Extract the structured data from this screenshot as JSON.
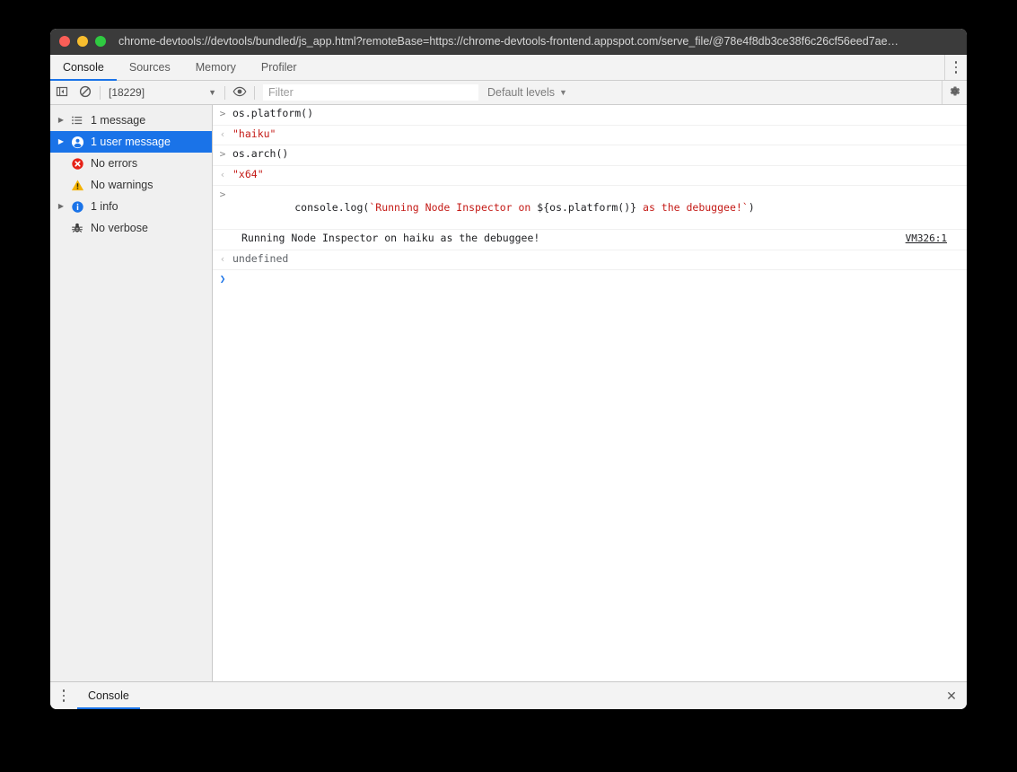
{
  "window": {
    "title": "chrome-devtools://devtools/bundled/js_app.html?remoteBase=https://chrome-devtools-frontend.appspot.com/serve_file/@78e4f8db3ce38f6c26cf56eed7ae…",
    "traffic_lights": [
      "close-red",
      "minimize-yellow",
      "zoom-green"
    ]
  },
  "tabbar": {
    "tabs": [
      {
        "label": "Console",
        "active": true
      },
      {
        "label": "Sources",
        "active": false
      },
      {
        "label": "Memory",
        "active": false
      },
      {
        "label": "Profiler",
        "active": false
      }
    ],
    "more_icon": "kebab-menu-icon"
  },
  "toolbar": {
    "sidebar_toggle_icon": "show-console-sidebar-icon",
    "clear_icon": "clear-console-icon",
    "context": {
      "value": "[18229]",
      "caret": "▼"
    },
    "eye_icon": "live-expression-eye-icon",
    "filter": {
      "value": "",
      "placeholder": "Filter"
    },
    "levels": {
      "label": "Default levels",
      "caret": "▼"
    },
    "settings_icon": "gear-icon"
  },
  "sidebar": {
    "items": [
      {
        "label": "1 message",
        "icon": "list-icon",
        "twisty": "▶",
        "selected": false
      },
      {
        "label": "1 user message",
        "icon": "user-icon",
        "twisty": "▶",
        "selected": true
      },
      {
        "label": "No errors",
        "icon": "error-icon",
        "twisty": "",
        "selected": false
      },
      {
        "label": "No warnings",
        "icon": "warning-icon",
        "twisty": "",
        "selected": false
      },
      {
        "label": "1 info",
        "icon": "info-icon",
        "twisty": "▶",
        "selected": false
      },
      {
        "label": "No verbose",
        "icon": "bug-icon",
        "twisty": "",
        "selected": false
      }
    ]
  },
  "console": {
    "rows": [
      {
        "gutter": ">",
        "kind": "input",
        "text": "os.platform()"
      },
      {
        "gutter": "‹",
        "kind": "output",
        "text": "\"haiku\"",
        "color": "string"
      },
      {
        "gutter": ">",
        "kind": "input",
        "text": "os.arch()"
      },
      {
        "gutter": "‹",
        "kind": "output",
        "text": "\"x64\"",
        "color": "string"
      },
      {
        "gutter": ">",
        "kind": "input",
        "text": "console.log(`Running Node Inspector on ${os.platform()} as the debuggee!`)",
        "parts": [
          {
            "t": "console.log(",
            "c": "plain"
          },
          {
            "t": "`Running Node Inspector on ",
            "c": "string"
          },
          {
            "t": "${",
            "c": "plain"
          },
          {
            "t": "os.platform()",
            "c": "plain"
          },
          {
            "t": "}",
            "c": "plain"
          },
          {
            "t": " as the debuggee!`",
            "c": "string"
          },
          {
            "t": ")",
            "c": "plain"
          }
        ]
      },
      {
        "gutter": "",
        "kind": "log",
        "text": "Running Node Inspector on haiku as the debuggee!",
        "link": "VM326:1"
      },
      {
        "gutter": "‹",
        "kind": "output",
        "text": "undefined",
        "color": "dim"
      },
      {
        "gutter": "❯",
        "kind": "prompt",
        "text": ""
      }
    ],
    "source_link": "VM326:1"
  },
  "drawer": {
    "kebab_icon": "kebab-menu-icon",
    "tabs": [
      {
        "label": "Console",
        "active": true
      }
    ],
    "close_icon": "close-icon"
  }
}
